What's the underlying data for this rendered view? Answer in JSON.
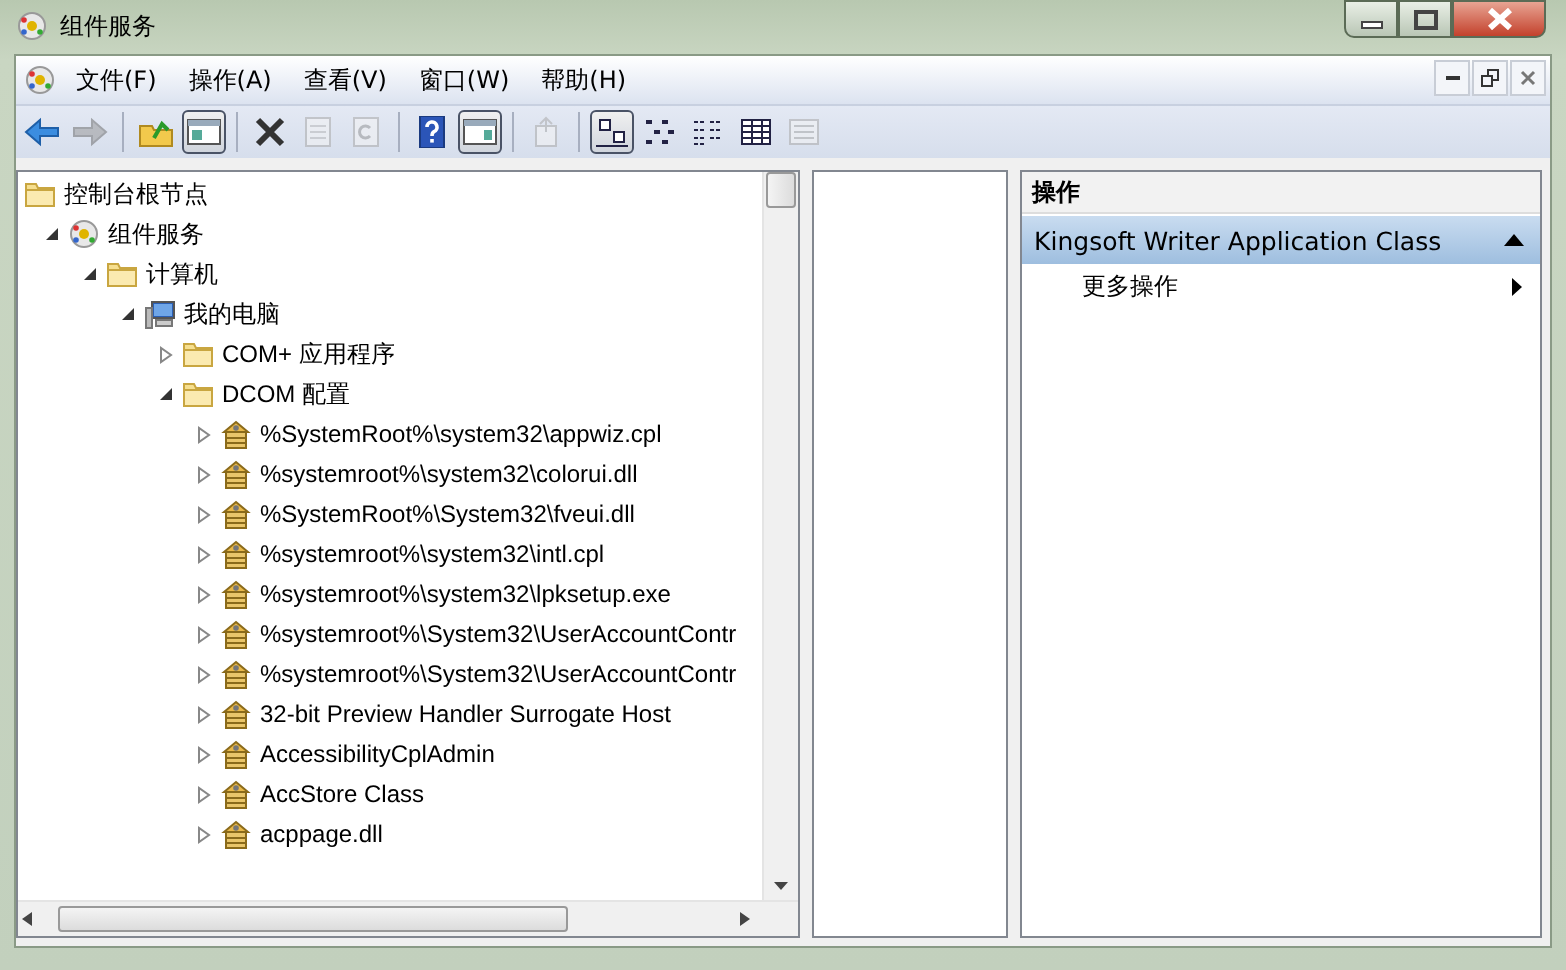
{
  "window": {
    "title": "组件服务"
  },
  "menu": [
    {
      "label": "文件(F)"
    },
    {
      "label": "操作(A)"
    },
    {
      "label": "查看(V)"
    },
    {
      "label": "窗口(W)"
    },
    {
      "label": "帮助(H)"
    }
  ],
  "toolbar": [
    {
      "kind": "back",
      "disabled": false,
      "pressed": false
    },
    {
      "kind": "forward",
      "disabled": true,
      "pressed": false
    },
    {
      "kind": "separator"
    },
    {
      "kind": "up",
      "disabled": false,
      "pressed": false
    },
    {
      "kind": "tree-pane",
      "disabled": false,
      "pressed": true
    },
    {
      "kind": "separator"
    },
    {
      "kind": "delete",
      "disabled": false,
      "pressed": false
    },
    {
      "kind": "properties",
      "disabled": true,
      "pressed": false
    },
    {
      "kind": "refresh",
      "disabled": true,
      "pressed": false
    },
    {
      "kind": "separator"
    },
    {
      "kind": "help",
      "disabled": false,
      "pressed": false
    },
    {
      "kind": "action-pane",
      "disabled": false,
      "pressed": true
    },
    {
      "kind": "separator"
    },
    {
      "kind": "export",
      "disabled": true,
      "pressed": false
    },
    {
      "kind": "separator"
    },
    {
      "kind": "large-icons",
      "disabled": false,
      "pressed": true
    },
    {
      "kind": "small-icons",
      "disabled": false,
      "pressed": false
    },
    {
      "kind": "list",
      "disabled": false,
      "pressed": false
    },
    {
      "kind": "details",
      "disabled": false,
      "pressed": false
    },
    {
      "kind": "custom",
      "disabled": true,
      "pressed": false
    }
  ],
  "tree": [
    {
      "label": "控制台根节点",
      "kind": "folder",
      "children": [
        {
          "label": "组件服务",
          "kind": "component",
          "expanded": true,
          "children": [
            {
              "label": "计算机",
              "kind": "folder",
              "expanded": true,
              "children": [
                {
                  "label": "我的电脑",
                  "kind": "computer",
                  "expanded": true,
                  "children": [
                    {
                      "label": "COM+ 应用程序",
                      "kind": "folder",
                      "expanded": false
                    },
                    {
                      "label": "DCOM 配置",
                      "kind": "folder",
                      "expanded": true,
                      "children": [
                        {
                          "label": "%SystemRoot%\\system32\\appwiz.cpl",
                          "kind": "package",
                          "expanded": false
                        },
                        {
                          "label": "%systemroot%\\system32\\colorui.dll",
                          "kind": "package",
                          "expanded": false
                        },
                        {
                          "label": "%SystemRoot%\\System32\\fveui.dll",
                          "kind": "package",
                          "expanded": false
                        },
                        {
                          "label": "%systemroot%\\system32\\intl.cpl",
                          "kind": "package",
                          "expanded": false
                        },
                        {
                          "label": "%systemroot%\\system32\\lpksetup.exe",
                          "kind": "package",
                          "expanded": false
                        },
                        {
                          "label": "%systemroot%\\System32\\UserAccountContr",
                          "kind": "package",
                          "expanded": false
                        },
                        {
                          "label": "%systemroot%\\System32\\UserAccountContr",
                          "kind": "package",
                          "expanded": false
                        },
                        {
                          "label": "32-bit Preview Handler Surrogate Host",
                          "kind": "package",
                          "expanded": false
                        },
                        {
                          "label": "AccessibilityCplAdmin",
                          "kind": "package",
                          "expanded": false
                        },
                        {
                          "label": "AccStore Class",
                          "kind": "package",
                          "expanded": false
                        },
                        {
                          "label": "acppage.dll",
                          "kind": "package",
                          "expanded": false
                        }
                      ]
                    }
                  ]
                }
              ]
            }
          ]
        }
      ]
    }
  ],
  "actions": {
    "header": "操作",
    "sections": [
      {
        "title": "Kingsoft Writer Application Class",
        "expanded": true,
        "items": [
          {
            "label": "更多操作",
            "has_submenu": true
          }
        ]
      }
    ]
  }
}
